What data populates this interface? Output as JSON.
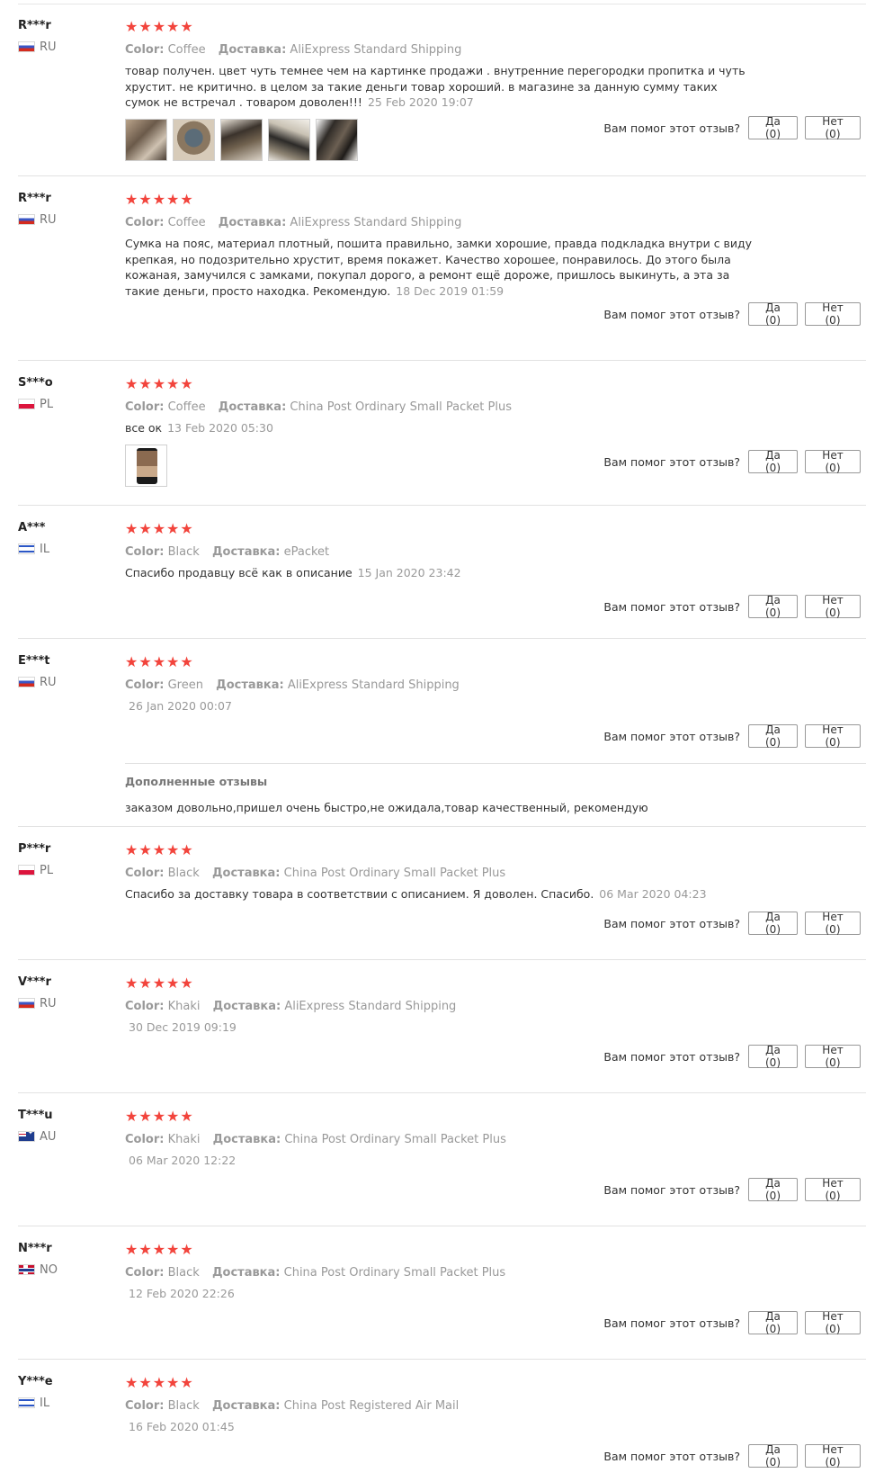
{
  "helpful_question": "Вам помог этот отзыв?",
  "yes_label": "Да (0)",
  "no_label": "Нет (0)",
  "color_label": "Color:",
  "shipping_label": "Доставка:",
  "stars": "★★★★★",
  "colors": {
    "star": "#f2443c",
    "divider": "#e2e2e2",
    "muted": "#999999"
  },
  "reviews": [
    {
      "user": "R***r",
      "country": "RU",
      "flag": "ru-flag",
      "color": "Coffee",
      "shipping": "AliExpress Standard Shipping",
      "text": "товар получен. цвет чуть темнее чем на картинке продажи . внутренние перегородки пропитка и чуть хрустит. не критично. в целом за такие деньги товар хороший. в магазине за данную сумму таких сумок не встречал . товаром доволен!!!",
      "date": "25 Feb 2020 19:07",
      "photos": 5
    },
    {
      "user": "R***r",
      "country": "RU",
      "flag": "ru-flag",
      "color": "Coffee",
      "shipping": "AliExpress Standard Shipping",
      "text": "Сумка на пояс, материал плотный, пошита правильно, замки хорошие, правда подкладка внутри с виду крепкая, но подозрительно хрустит, время покажет. Качество хорошее, понравилось. До этого была кожаная, замучился с замками, покупал дорого, а ремонт ещё дороже, пришлось выкинуть, а эта за такие деньги, просто находка. Рекомендую.",
      "date": "18 Dec 2019 01:59"
    },
    {
      "user": "S***o",
      "country": "PL",
      "flag": "pl-flag",
      "color": "Coffee",
      "shipping": "China Post Ordinary Small Packet Plus",
      "text": "все ок",
      "date": "13 Feb 2020 05:30",
      "photos": 1
    },
    {
      "user": "A***",
      "country": "IL",
      "flag": "il-flag",
      "color": "Black",
      "shipping": "ePacket",
      "text": "Спасибо продавцу всё как в описание",
      "date": "15 Jan 2020 23:42"
    },
    {
      "user": "E***t",
      "country": "RU",
      "flag": "ru-flag",
      "color": "Green",
      "shipping": "AliExpress Standard Shipping",
      "date": "26 Jan 2020 00:07",
      "followup_title": "Дополненные отзывы",
      "followup_text": "заказом довольно,пришел очень быстро,не ожидала,товар качественный, рекомендую"
    },
    {
      "user": "P***r",
      "country": "PL",
      "flag": "pl-flag",
      "color": "Black",
      "shipping": "China Post Ordinary Small Packet Plus",
      "text": "Спасибо за доставку товара в соответствии с описанием. Я доволен. Спасибо.",
      "date": "06 Mar 2020 04:23"
    },
    {
      "user": "V***r",
      "country": "RU",
      "flag": "ru-flag",
      "color": "Khaki",
      "shipping": "AliExpress Standard Shipping",
      "date": "30 Dec 2019 09:19"
    },
    {
      "user": "T***u",
      "country": "AU",
      "flag": "au-flag",
      "color": "Khaki",
      "shipping": "China Post Ordinary Small Packet Plus",
      "date": "06 Mar 2020 12:22"
    },
    {
      "user": "N***r",
      "country": "NO",
      "flag": "no-flag",
      "color": "Black",
      "shipping": "China Post Ordinary Small Packet Plus",
      "date": "12 Feb 2020 22:26"
    },
    {
      "user": "Y***e",
      "country": "IL",
      "flag": "il-flag",
      "color": "Black",
      "shipping": "China Post Registered Air Mail",
      "date": "16 Feb 2020 01:45"
    }
  ]
}
